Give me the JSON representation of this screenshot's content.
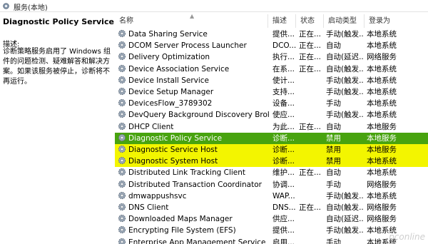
{
  "window": {
    "title": "服务(本地)"
  },
  "left_pane": {
    "service_name": "Diagnostic Policy Service",
    "description_label": "描述:",
    "description": "诊断策略服务启用了 Windows 组件的问题检测、疑难解答和解决方案。如果该服务被停止，诊断将不再运行。"
  },
  "columns": {
    "name": "名称",
    "description": "描述",
    "status": "状态",
    "startup": "启动类型",
    "logon": "登录为"
  },
  "rows": [
    {
      "name": "Data Sharing Service",
      "description": "提供...",
      "status": "正在...",
      "startup": "手动(触发...",
      "logon": "本地系统"
    },
    {
      "name": "DCOM Server Process Launcher",
      "description": "DCO...",
      "status": "正在...",
      "startup": "自动",
      "logon": "本地系统"
    },
    {
      "name": "Delivery Optimization",
      "description": "执行...",
      "status": "正在...",
      "startup": "自动(延迟...",
      "logon": "网络服务"
    },
    {
      "name": "Device Association Service",
      "description": "在系...",
      "status": "正在...",
      "startup": "自动(触发...",
      "logon": "本地系统"
    },
    {
      "name": "Device Install Service",
      "description": "使计...",
      "status": "",
      "startup": "手动(触发...",
      "logon": "本地系统"
    },
    {
      "name": "Device Setup Manager",
      "description": "支持...",
      "status": "",
      "startup": "手动(触发...",
      "logon": "本地系统"
    },
    {
      "name": "DevicesFlow_3789302",
      "description": "设备...",
      "status": "",
      "startup": "手动",
      "logon": "本地系统"
    },
    {
      "name": "DevQuery Background Discovery Broker",
      "description": "使应...",
      "status": "",
      "startup": "手动(触发...",
      "logon": "本地系统"
    },
    {
      "name": "DHCP Client",
      "description": "为此...",
      "status": "正在...",
      "startup": "自动",
      "logon": "本地服务"
    },
    {
      "name": "Diagnostic Policy Service",
      "description": "诊断...",
      "status": "",
      "startup": "禁用",
      "logon": "本地服务"
    },
    {
      "name": "Diagnostic Service Host",
      "description": "诊断...",
      "status": "",
      "startup": "禁用",
      "logon": "本地服务"
    },
    {
      "name": "Diagnostic System Host",
      "description": "诊断...",
      "status": "",
      "startup": "禁用",
      "logon": "本地系统"
    },
    {
      "name": "Distributed Link Tracking Client",
      "description": "维护...",
      "status": "正在...",
      "startup": "自动",
      "logon": "本地系统"
    },
    {
      "name": "Distributed Transaction Coordinator",
      "description": "协调...",
      "status": "",
      "startup": "手动",
      "logon": "网络服务"
    },
    {
      "name": "dmwappushsvc",
      "description": "WAP...",
      "status": "",
      "startup": "手动(触发...",
      "logon": "本地系统"
    },
    {
      "name": "DNS Client",
      "description": "DNS...",
      "status": "正在...",
      "startup": "自动(触发...",
      "logon": "网络服务"
    },
    {
      "name": "Downloaded Maps Manager",
      "description": "供应...",
      "status": "",
      "startup": "自动(延迟...",
      "logon": "网络服务"
    },
    {
      "name": "Encrypting File System (EFS)",
      "description": "提供...",
      "status": "",
      "startup": "手动(触发...",
      "logon": "本地系统"
    },
    {
      "name": "Enterprise App Management Service",
      "description": "启用...",
      "status": "",
      "startup": "手动",
      "logon": "本地系统"
    }
  ],
  "selected_row": 9,
  "highlighted_rows": [
    10,
    11
  ],
  "colors": {
    "selected": "#48a30f",
    "highlight": "#f3f500"
  },
  "icons": {
    "title": "gear-icon",
    "row": "gear-icon"
  },
  "watermark": "pconline"
}
